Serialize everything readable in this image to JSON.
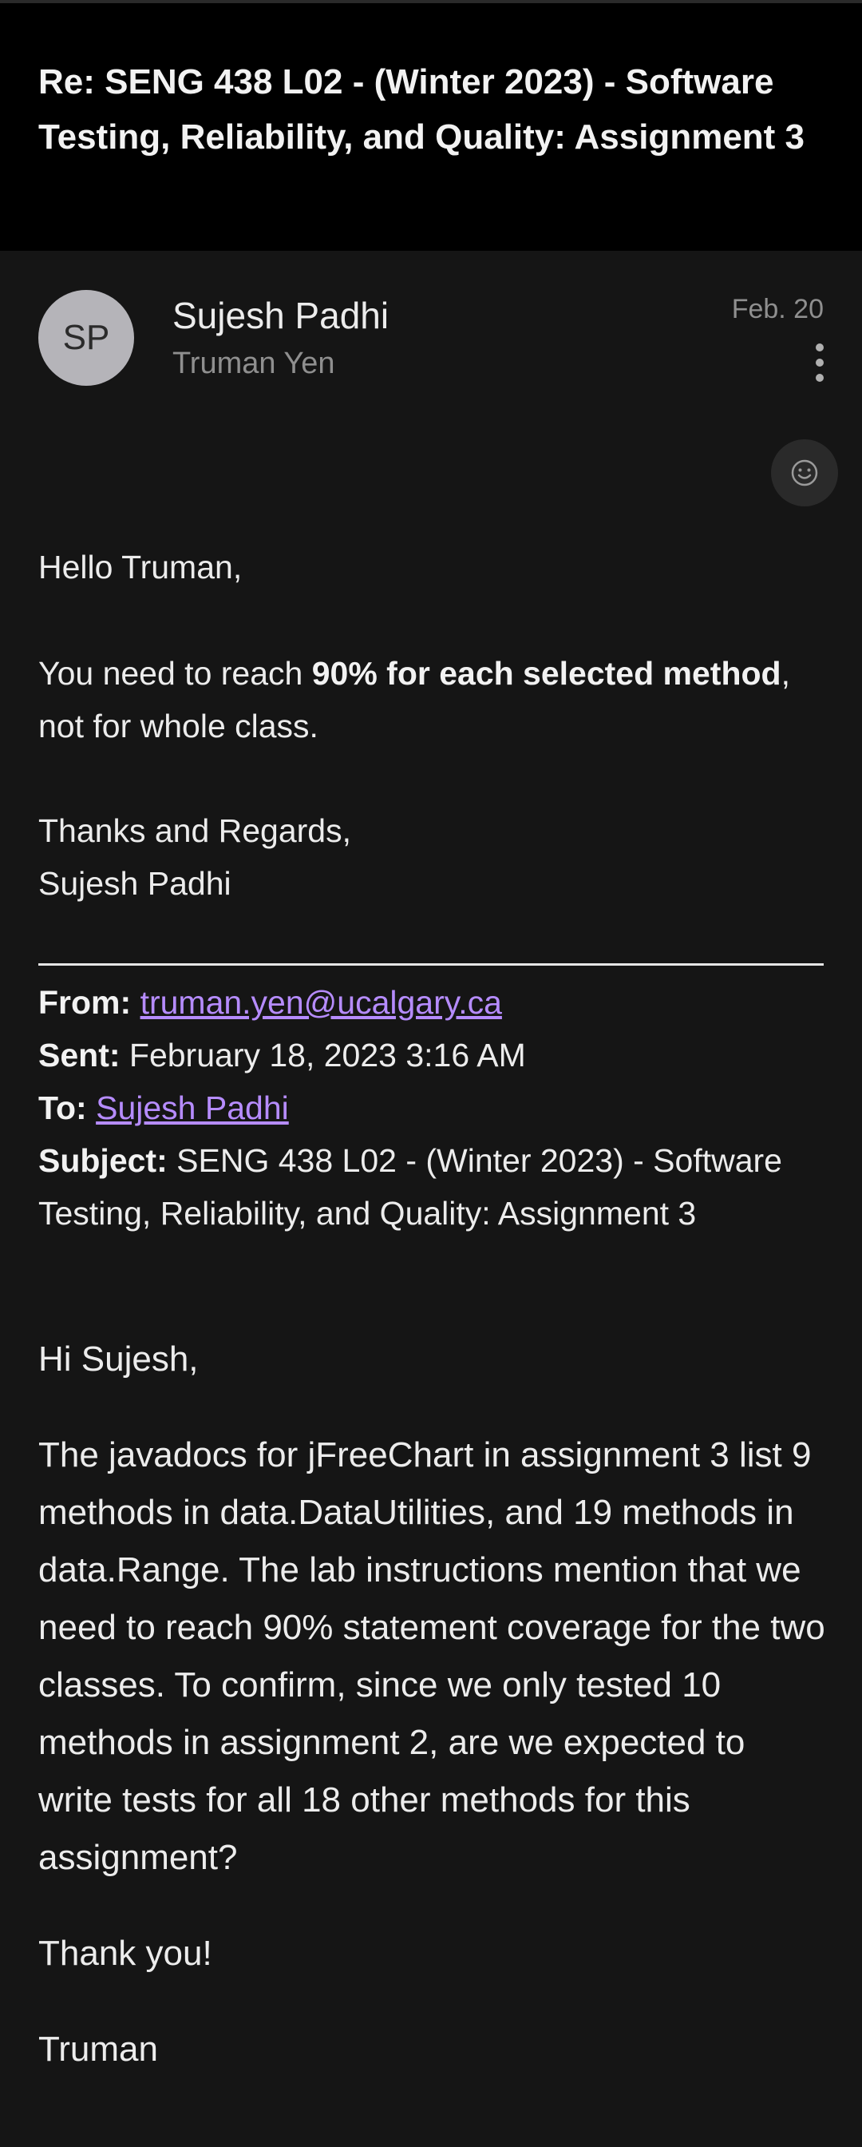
{
  "subject": "Re: SENG 438 L02 - (Winter 2023) - Software Testing, Reliability, and Quality: Assignment 3",
  "sender": {
    "initials": "SP",
    "name": "Sujesh Padhi",
    "recipient": "Truman Yen",
    "date": "Feb. 20"
  },
  "reply": {
    "greeting": "Hello Truman,",
    "line_pre": "You need to reach ",
    "line_bold": "90% for each selected method",
    "line_post": ", not for whole class.",
    "signoff_1": "Thanks and Regards,",
    "signoff_2": "Sujesh Padhi"
  },
  "quoted_header": {
    "from_label": "From:",
    "from_value": "truman.yen@ucalgary.ca",
    "sent_label": "Sent:",
    "sent_value": "February 18, 2023 3:16 AM",
    "to_label": "To:",
    "to_value": "Sujesh Padhi",
    "subject_label": "Subject:",
    "subject_value": "SENG 438 L02 - (Winter 2023) - Software Testing, Reliability, and Quality: Assignment 3"
  },
  "original": {
    "greeting": "Hi Sujesh,",
    "body": "The javadocs for jFreeChart in assignment 3 list 9 methods in data.DataUtilities, and 19 methods in data.Range.  The lab instructions mention that we need to reach 90% statement coverage for the two classes.  To confirm, since we only tested 10 methods in assignment 2, are we expected to write tests for all 18 other methods for this assignment?",
    "thanks": "Thank you!",
    "signature": "Truman"
  },
  "icons": {
    "more": "more-vertical-icon",
    "react": "emoji-reaction-icon"
  }
}
